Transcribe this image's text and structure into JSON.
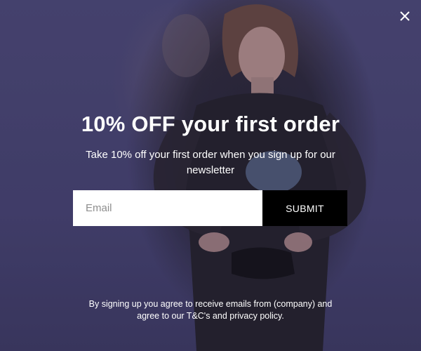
{
  "popup": {
    "close_icon": "close-icon",
    "title": "10% OFF your first order",
    "subtitle": "Take 10% off your first order when you sign up for our newsletter",
    "email_placeholder": "Email",
    "email_value": "",
    "submit_label": "SUBMIT",
    "legal_line1": "By signing up you agree to receive emails from (company) and",
    "legal_line2": "agree to our T&C's and privacy policy."
  },
  "colors": {
    "background": "#4b4775",
    "button": "#000000",
    "text": "#ffffff"
  }
}
